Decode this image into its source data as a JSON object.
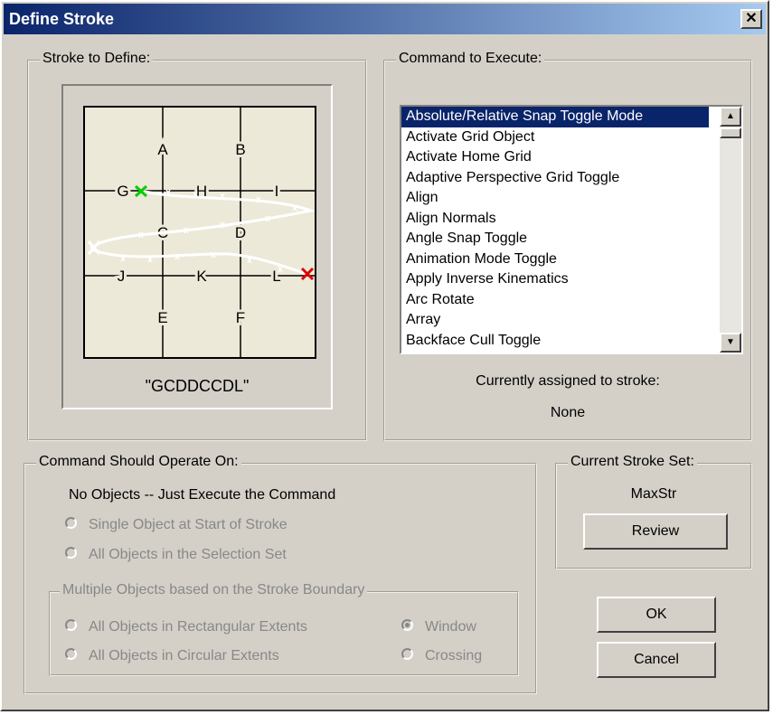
{
  "window": {
    "title": "Define Stroke",
    "close_glyph": "✕"
  },
  "stroke_group": {
    "label": "Stroke to Define:",
    "grid_labels": [
      "A",
      "B",
      "G",
      "H",
      "I",
      "C",
      "D",
      "J",
      "K",
      "L",
      "E",
      "F"
    ],
    "stroke_string": "\"GCDDCCDL\""
  },
  "command_group": {
    "label": "Command to Execute:",
    "items": [
      "Absolute/Relative Snap Toggle Mode",
      "Activate Grid Object",
      "Activate Home Grid",
      "Adaptive Perspective Grid Toggle",
      "Align",
      "Align Normals",
      "Angle Snap Toggle",
      "Animation Mode Toggle",
      "Apply Inverse Kinematics",
      "Arc Rotate",
      "Array",
      "Backface Cull Toggle"
    ],
    "selected_index": 0,
    "assigned_label": "Currently assigned to stroke:",
    "assigned_value": "None",
    "scroll_up": "▲",
    "scroll_down": "▼"
  },
  "operate_group": {
    "label": "Command Should Operate On:",
    "mode_text": "No Objects -- Just Execute the Command",
    "options": [
      "Single Object at Start of Stroke",
      "All Objects in the Selection Set"
    ],
    "multi": {
      "label": "Multiple Objects based on the Stroke Boundary",
      "options": [
        "All Objects in Rectangular Extents",
        "All Objects in Circular Extents"
      ],
      "window_label": "Window",
      "crossing_label": "Crossing"
    }
  },
  "stroke_set": {
    "label": "Current Stroke Set:",
    "value": "MaxStr",
    "review_label": "Review"
  },
  "buttons": {
    "ok": "OK",
    "cancel": "Cancel"
  },
  "colors": {
    "title_start": "#0a246a",
    "title_end": "#a6caf0",
    "start_marker": "#00cc00",
    "end_marker": "#dd0000",
    "stroke": "#ffffff"
  }
}
